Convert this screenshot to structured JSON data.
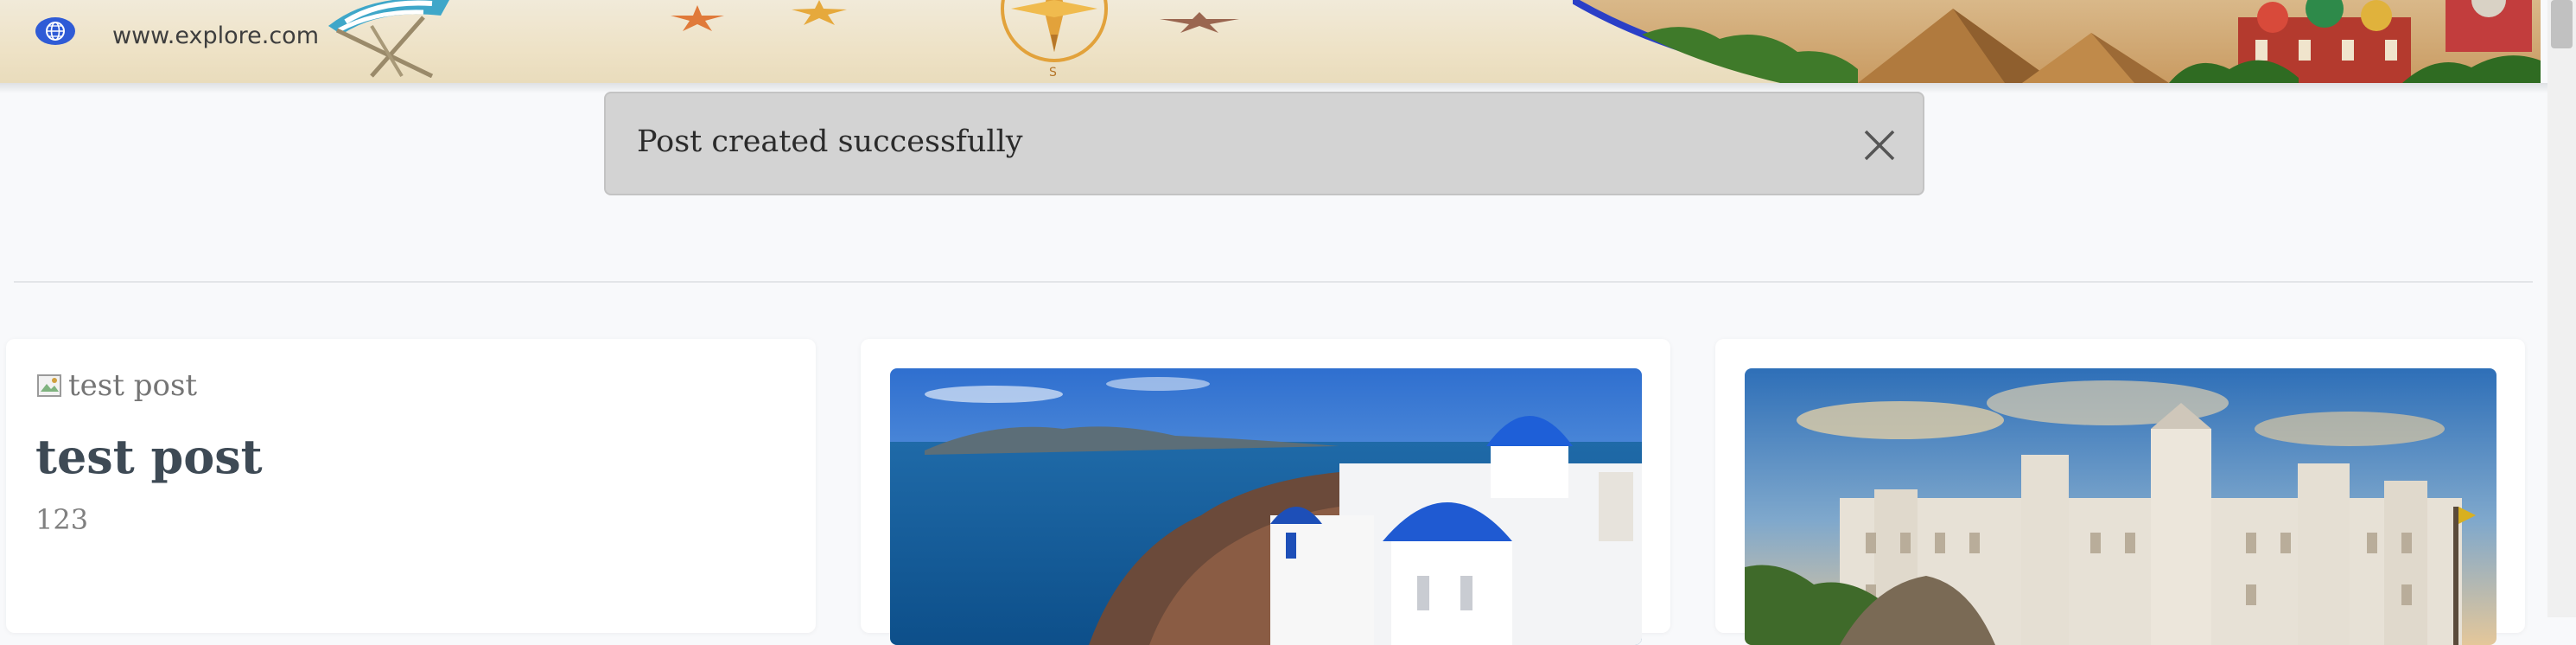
{
  "header": {
    "site_url": "www.explore.com"
  },
  "alert": {
    "message": "Post created successfully"
  },
  "posts": [
    {
      "image_alt": "test post",
      "title": "test post",
      "body": "123"
    },
    {
      "image_subject": "santorini-photo"
    },
    {
      "image_subject": "madrid-palace-photo"
    }
  ]
}
